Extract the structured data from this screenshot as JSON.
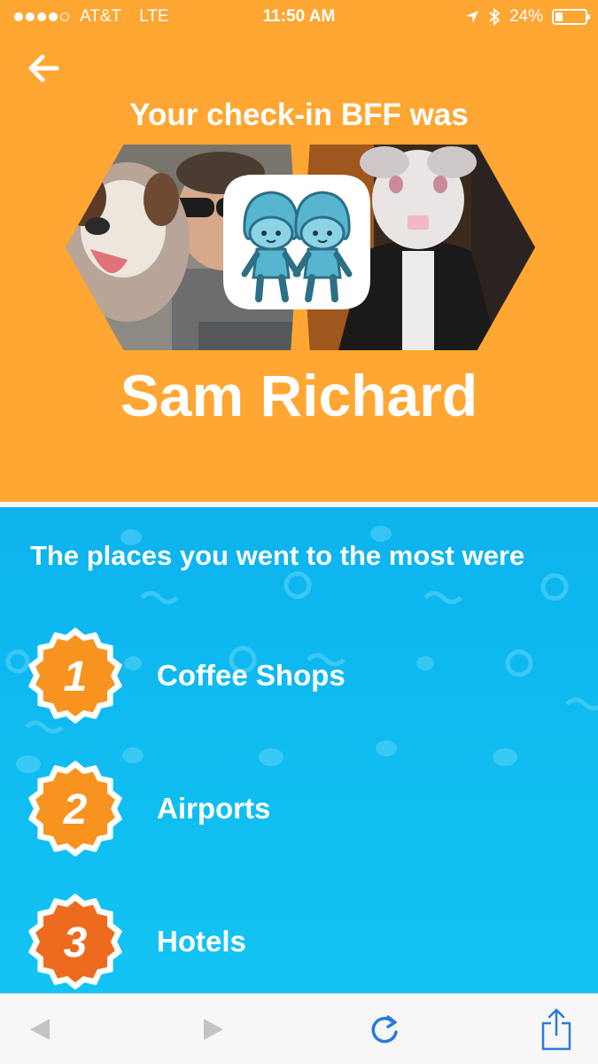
{
  "status_bar": {
    "carrier": "AT&T",
    "network": "LTE",
    "time": "11:50 AM",
    "battery": "24%",
    "battery_level": 0.24,
    "icons": [
      "location-arrow-icon",
      "bluetooth-icon",
      "battery-icon"
    ]
  },
  "header": {
    "back_icon": "back-arrow-icon",
    "headline": "Your check-in BFF was",
    "badge_icon": "twins-icon",
    "bff_name": "Sam Richard"
  },
  "places": {
    "heading": "The places you went to the most were",
    "items": [
      {
        "rank": "1",
        "label": "Coffee Shops",
        "badge_color": "#F7931E"
      },
      {
        "rank": "2",
        "label": "Airports",
        "badge_color": "#F7931E"
      },
      {
        "rank": "3",
        "label": "Hotels",
        "badge_color": "#EE6A1E"
      }
    ]
  },
  "toolbar": {
    "icons": [
      "back-triangle-icon",
      "forward-triangle-icon",
      "reload-icon",
      "share-icon"
    ]
  },
  "colors": {
    "orange_panel": "#FFA633",
    "blue_panel": "#0DB3EE",
    "ios_blue": "#2A7BD8"
  }
}
